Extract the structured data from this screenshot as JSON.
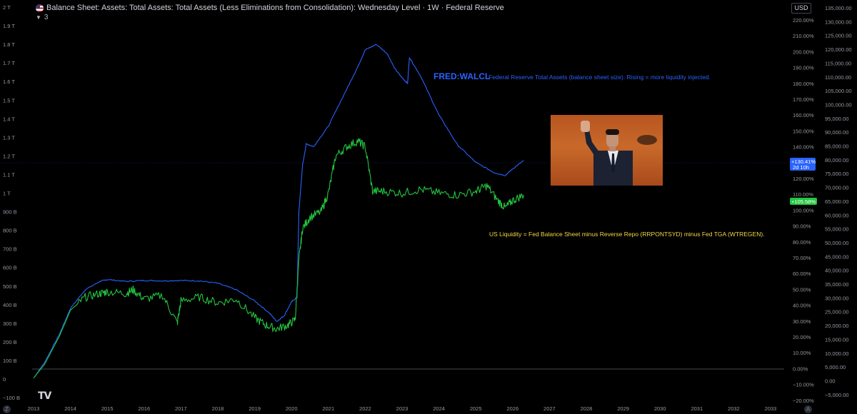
{
  "header": {
    "title": "Balance Sheet: Assets: Total Assets: Total Assets (Less Eliminations from Consolidation): Wednesday Level · 1W · Federal Reserve",
    "indicator_count": "3",
    "currency": "USD",
    "logo": "TV",
    "timezone_icon": "Z",
    "auto_icon": "A"
  },
  "annotations": {
    "walcl_label": "FRED:WALCL",
    "walcl_desc": "Federal Reserve Total Assets (balance sheet size). Rising = more liquidity injected.",
    "liquidity_desc": "US Liquidity = Fed Balance Sheet minus Reverse Repo (RRPONTSYD) minus Fed TGA (WTREGEN)."
  },
  "badges": {
    "blue_pct": "+130.41%",
    "blue_countdown": "2d 10h",
    "green_pct": "+105.58%"
  },
  "colors": {
    "walcl": "#2962ff",
    "liquidity": "#22c53e",
    "background": "#000000",
    "grid": "#1a1d24",
    "text": "#d1d4dc"
  },
  "chart_data": {
    "type": "line",
    "x_ticks": [
      "2013",
      "2014",
      "2015",
      "2016",
      "2017",
      "2018",
      "2019",
      "2020",
      "2021",
      "2022",
      "2023",
      "2024",
      "2025",
      "2026",
      "2027",
      "2028",
      "2029",
      "2030",
      "2031",
      "2032",
      "2033"
    ],
    "left_axis_ticks": [
      "2 T",
      "1.9 T",
      "1.8 T",
      "1.7 T",
      "1.6 T",
      "1.5 T",
      "1.4 T",
      "1.3 T",
      "1.2 T",
      "1.1 T",
      "1 T",
      "900 B",
      "800 B",
      "700 B",
      "600 B",
      "500 B",
      "400 B",
      "300 B",
      "200 B",
      "100 B",
      "0",
      "−100 B"
    ],
    "pct_axis_ticks": [
      "220.00%",
      "210.00%",
      "200.00%",
      "190.00%",
      "180.00%",
      "170.00%",
      "160.00%",
      "150.00%",
      "140.00%",
      "130.00%",
      "120.00%",
      "110.00%",
      "100.00%",
      "90.00%",
      "80.00%",
      "70.00%",
      "60.00%",
      "50.00%",
      "40.00%",
      "30.00%",
      "20.00%",
      "10.00%",
      "0.00%",
      "−10.00%",
      "−20.00%"
    ],
    "right_axis_ticks": [
      "135,000.00",
      "130,000.00",
      "125,000.00",
      "120,000.00",
      "115,000.00",
      "110,000.00",
      "105,000.00",
      "100,000.00",
      "95,000.00",
      "90,000.00",
      "85,000.00",
      "80,000.00",
      "75,000.00",
      "70,000.00",
      "65,000.00",
      "60,000.00",
      "55,000.00",
      "50,000.00",
      "45,000.00",
      "40,000.00",
      "35,000.00",
      "30,000.00",
      "25,000.00",
      "20,000.00",
      "15,000.00",
      "10,000.00",
      "5,000.00",
      "0.00",
      "−5,000.00"
    ],
    "left_axis_range": [
      -100,
      2000
    ],
    "series": [
      {
        "name": "FRED:WALCL",
        "color": "#2962ff",
        "x": [
          2013.0,
          2013.3,
          2013.7,
          2014.0,
          2014.4,
          2014.8,
          2015.0,
          2015.5,
          2016.0,
          2016.5,
          2017.0,
          2017.5,
          2018.0,
          2018.5,
          2019.0,
          2019.4,
          2019.6,
          2019.8,
          2020.0,
          2020.15,
          2020.2,
          2020.3,
          2020.4,
          2020.6,
          2021.0,
          2021.5,
          2021.8,
          2022.0,
          2022.3,
          2022.6,
          2022.8,
          2023.0,
          2023.15,
          2023.2,
          2023.5,
          2024.0,
          2024.5,
          2025.0,
          2025.5,
          2025.8,
          2026.0,
          2026.3
        ],
        "y": [
          5,
          90,
          240,
          380,
          480,
          525,
          535,
          525,
          530,
          528,
          530,
          528,
          515,
          480,
          420,
          355,
          310,
          340,
          415,
          440,
          900,
          1150,
          1265,
          1250,
          1360,
          1560,
          1680,
          1770,
          1800,
          1750,
          1670,
          1620,
          1590,
          1730,
          1630,
          1420,
          1260,
          1165,
          1110,
          1095,
          1130,
          1175
        ]
      },
      {
        "name": "US Liquidity",
        "color": "#22c53e",
        "x": [
          2013.0,
          2013.3,
          2013.7,
          2014.0,
          2014.4,
          2014.8,
          2015.0,
          2015.5,
          2015.7,
          2016.0,
          2016.5,
          2016.9,
          2017.0,
          2017.5,
          2018.0,
          2018.5,
          2019.0,
          2019.3,
          2019.6,
          2019.9,
          2020.1,
          2020.2,
          2020.3,
          2020.5,
          2020.8,
          2021.0,
          2021.2,
          2021.5,
          2021.8,
          2022.0,
          2022.2,
          2022.5,
          2023.0,
          2023.5,
          2024.0,
          2024.5,
          2025.0,
          2025.3,
          2025.6,
          2025.8,
          2026.0,
          2026.3
        ],
        "y": [
          5,
          80,
          230,
          370,
          440,
          460,
          470,
          460,
          480,
          430,
          450,
          300,
          420,
          440,
          410,
          430,
          330,
          290,
          270,
          290,
          320,
          640,
          810,
          870,
          900,
          1000,
          1200,
          1250,
          1280,
          1250,
          1010,
          1010,
          1000,
          1020,
          1000,
          990,
          1010,
          1040,
          960,
          920,
          960,
          990
        ]
      }
    ],
    "xlabel": "",
    "ylabel": ""
  }
}
